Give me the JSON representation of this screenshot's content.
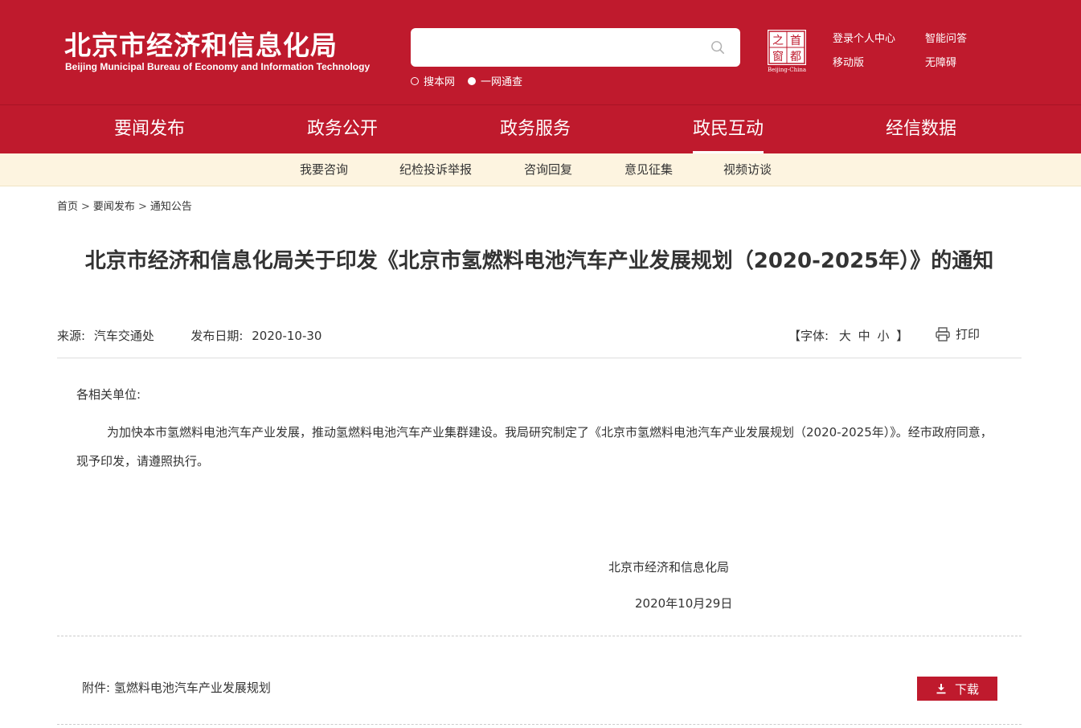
{
  "header": {
    "title": "北京市经济和信息化局",
    "subtitle": "Beijing Municipal Bureau of Economy and Information Technology",
    "search_placeholder": "",
    "search_options": [
      {
        "label": "搜本网",
        "selected": false
      },
      {
        "label": "一网通查",
        "selected": true
      }
    ],
    "capital_logo": {
      "chars": [
        "之",
        "首",
        "窗",
        "都"
      ],
      "caption": "Beijing-China"
    },
    "top_links": [
      "登录个人中心",
      "智能问答",
      "移动版",
      "无障碍"
    ]
  },
  "nav": {
    "items": [
      "要闻发布",
      "政务公开",
      "政务服务",
      "政民互动",
      "经信数据"
    ],
    "active": "政民互动"
  },
  "subnav": {
    "items": [
      "我要咨询",
      "纪检投诉举报",
      "咨询回复",
      "意见征集",
      "视频访谈"
    ]
  },
  "breadcrumb": {
    "items": [
      "首页",
      "要闻发布",
      "通知公告"
    ],
    "separator": ">"
  },
  "article": {
    "title": "北京市经济和信息化局关于印发《北京市氢燃料电池汽车产业发展规划（2020-2025年）》的通知",
    "source_label": "来源:",
    "source": "汽车交通处",
    "date_label": "发布日期:",
    "date": "2020-10-30",
    "font_label_open": "【字体:",
    "font_sizes": [
      "大",
      "中",
      "小"
    ],
    "font_label_close": "】",
    "print_label": "打印",
    "greeting": "各相关单位:",
    "body": "为加快本市氢燃料电池汽车产业发展，推动氢燃料电池汽车产业集群建设。我局研究制定了《北京市氢燃料电池汽车产业发展规划（2020-2025年）》。经市政府同意，现予印发，请遵照执行。",
    "signature_org": "北京市经济和信息化局",
    "signature_date": "2020年10月29日",
    "attachment_label": "附件:",
    "attachment_name": "氢燃料电池汽车产业发展规划",
    "download_label": "下载"
  },
  "colors": {
    "brand_red": "#bf1a2d",
    "subnav_bg": "#fdf4e0"
  }
}
